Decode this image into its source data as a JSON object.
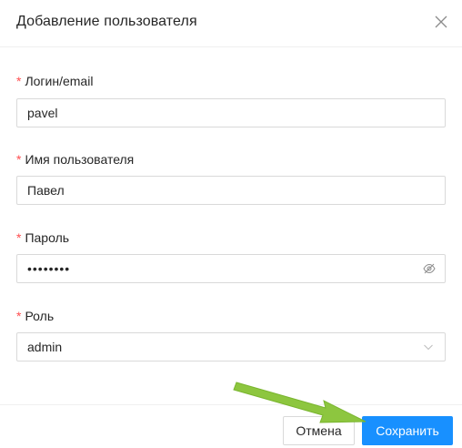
{
  "modal": {
    "title": "Добавление пользователя"
  },
  "form": {
    "login": {
      "label": "Логин/email",
      "value": "pavel"
    },
    "username": {
      "label": "Имя пользователя",
      "value": "Павел"
    },
    "password": {
      "label": "Пароль",
      "value": "••••••••"
    },
    "role": {
      "label": "Роль",
      "value": "admin"
    },
    "required_mark": "*"
  },
  "footer": {
    "cancel_label": "Отмена",
    "save_label": "Сохранить"
  },
  "colors": {
    "primary": "#1890ff",
    "required": "#ff4d4f",
    "annotation_arrow": "#8dc63f"
  },
  "icons": {
    "close": "close-icon",
    "password_toggle": "eye-invisible-icon",
    "select_arrow": "chevron-down-icon"
  }
}
